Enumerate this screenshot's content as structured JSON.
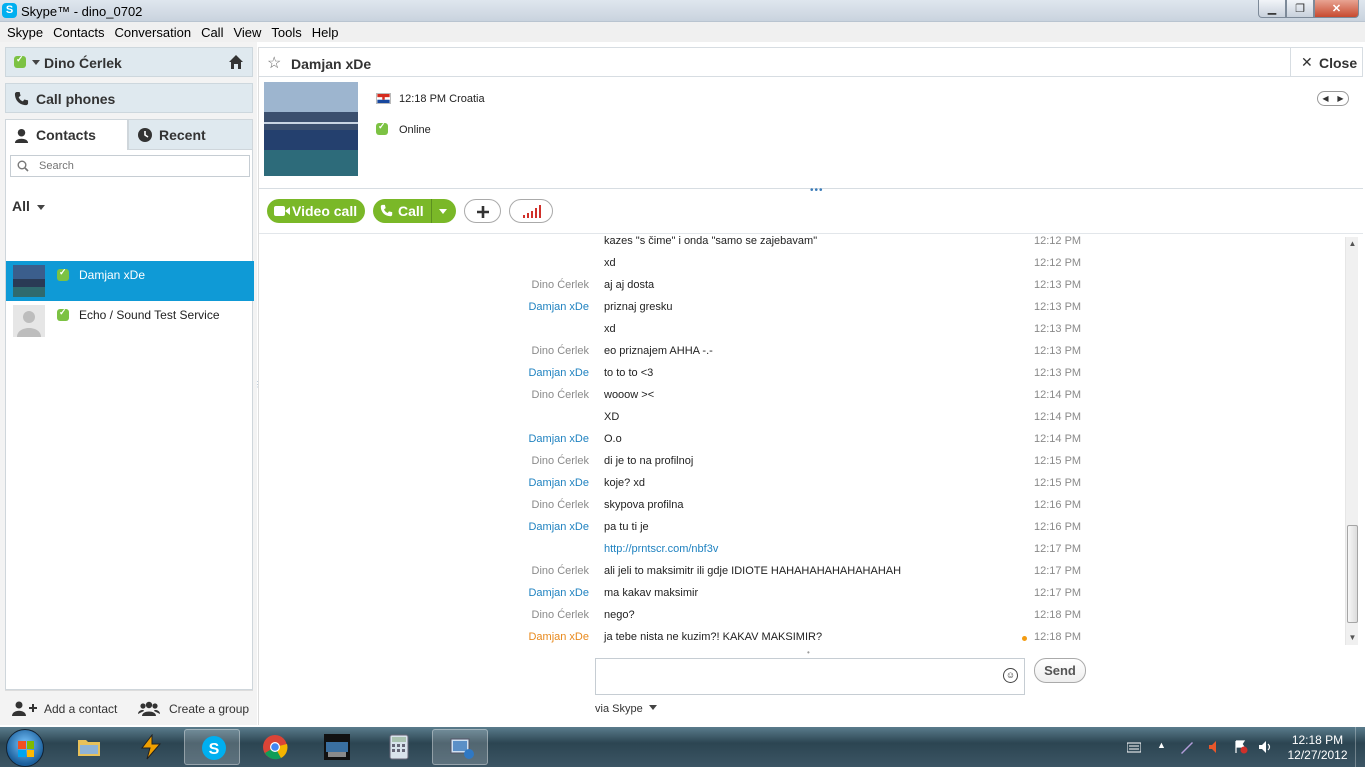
{
  "window": {
    "title": "Skype™ - dino_0702"
  },
  "menu": [
    "Skype",
    "Contacts",
    "Conversation",
    "Call",
    "View",
    "Tools",
    "Help"
  ],
  "profile": {
    "name": "Dino Ćerlek"
  },
  "call_phones_label": "Call phones",
  "tabs": {
    "contacts": "Contacts",
    "recent": "Recent"
  },
  "search": {
    "placeholder": "Search",
    "value": ""
  },
  "filter_label": "All",
  "contacts": [
    {
      "name": "Damjan xDe",
      "selected": true
    },
    {
      "name": "Echo / Sound Test Service",
      "selected": false
    }
  ],
  "footer": {
    "add_contact": "Add a contact",
    "create_group": "Create a group"
  },
  "conversation": {
    "name": "Damjan xDe",
    "close_label": "Close",
    "time_location": "12:18 PM Croatia",
    "status": "Online"
  },
  "toolbar": {
    "video_call": "Video call",
    "call": "Call"
  },
  "messages": [
    {
      "author": "",
      "text": "kazes \"s čime\" i onda \"samo se zajebavam\"",
      "time": "12:12 PM",
      "who": "me"
    },
    {
      "author": "",
      "text": "xd",
      "time": "12:12 PM",
      "who": "me"
    },
    {
      "author": "Dino Ćerlek",
      "text": "aj aj dosta",
      "time": "12:13 PM",
      "who": "me"
    },
    {
      "author": "Damjan xDe",
      "text": "priznaj gresku",
      "time": "12:13 PM",
      "who": "them"
    },
    {
      "author": "",
      "text": "xd",
      "time": "12:13 PM",
      "who": "them"
    },
    {
      "author": "Dino Ćerlek",
      "text": "eo priznajem AHHA -.-",
      "time": "12:13 PM",
      "who": "me"
    },
    {
      "author": "Damjan xDe",
      "text": "to to to <3",
      "time": "12:13 PM",
      "who": "them"
    },
    {
      "author": "Dino Ćerlek",
      "text": "wooow ><",
      "time": "12:14 PM",
      "who": "me"
    },
    {
      "author": "",
      "text": "XD",
      "time": "12:14 PM",
      "who": "me"
    },
    {
      "author": "Damjan xDe",
      "text": "O.o",
      "time": "12:14 PM",
      "who": "them"
    },
    {
      "author": "Dino Ćerlek",
      "text": "di je to  na profilnoj",
      "time": "12:15 PM",
      "who": "me"
    },
    {
      "author": "Damjan xDe",
      "text": "koje? xd",
      "time": "12:15 PM",
      "who": "them"
    },
    {
      "author": "Dino Ćerlek",
      "text": "skypova profilna",
      "time": "12:16 PM",
      "who": "me"
    },
    {
      "author": "Damjan xDe",
      "text": "pa tu ti je",
      "time": "12:16 PM",
      "who": "them"
    },
    {
      "author": "",
      "text": "http://prntscr.com/nbf3v",
      "time": "12:17 PM",
      "who": "them",
      "link": true
    },
    {
      "author": "Dino Ćerlek",
      "text": "ali jeli to maksimitr ili gdje IDIOTE HAHAHAHAHAHAHAHAH",
      "time": "12:17 PM",
      "who": "me"
    },
    {
      "author": "Damjan xDe",
      "text": "ma kakav maksimir",
      "time": "12:17 PM",
      "who": "them"
    },
    {
      "author": "Dino Ćerlek",
      "text": "nego?",
      "time": "12:18 PM",
      "who": "me"
    },
    {
      "author": "Damjan xDe",
      "text": "ja tebe nista ne kuzim?! KAKAV MAKSIMIR?",
      "time": "12:18 PM",
      "who": "last",
      "pending": true
    }
  ],
  "composer": {
    "value": "",
    "send_label": "Send",
    "via_label": "via Skype"
  },
  "taskbar": {
    "time": "12:18 PM",
    "date": "12/27/2012"
  },
  "colors": {
    "accent": "#0f9ad6",
    "green": "#7ab828",
    "link": "#1f82c0",
    "pending": "#f39c12"
  }
}
